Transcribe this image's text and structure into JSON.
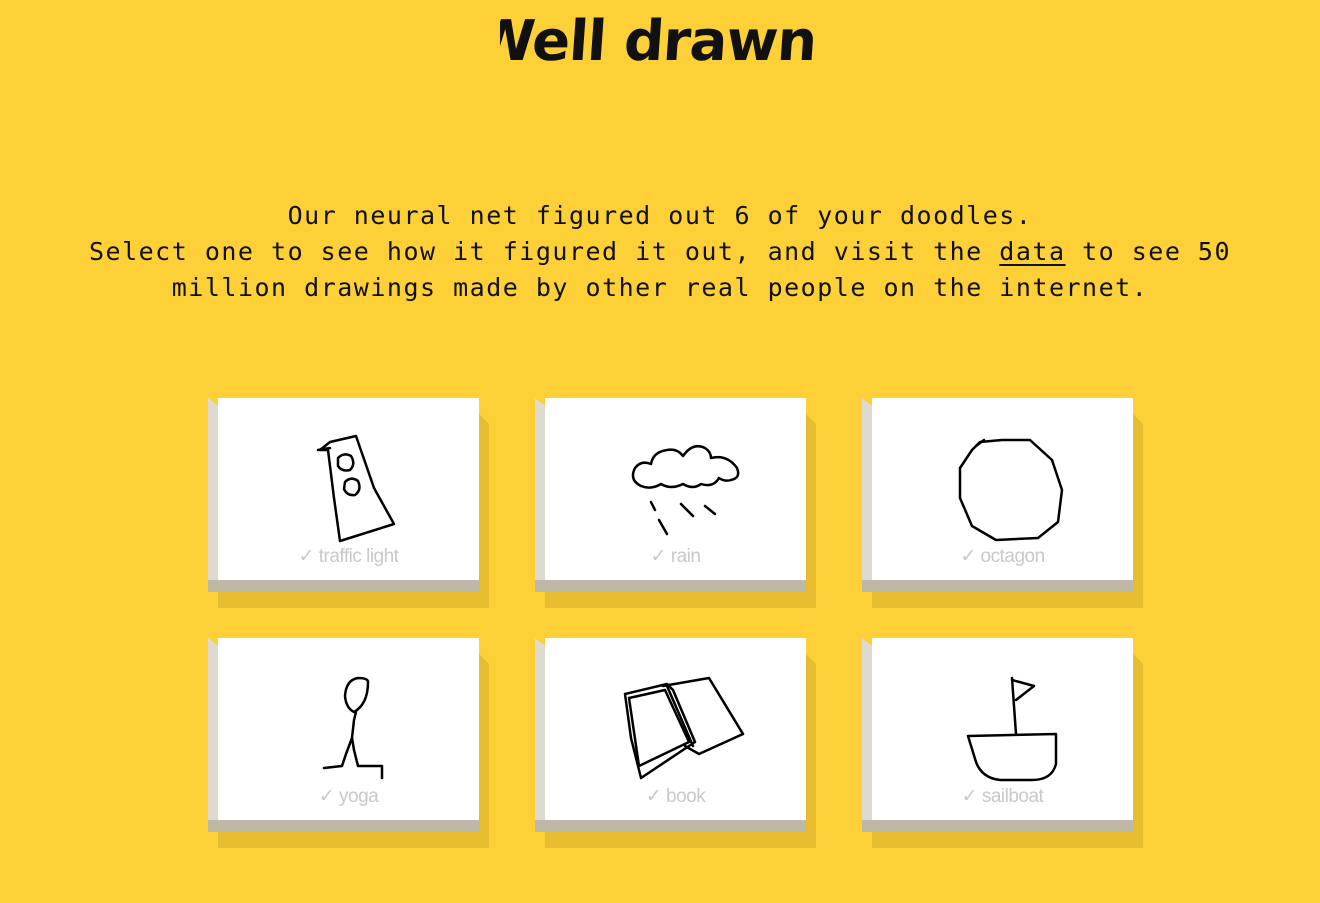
{
  "heading": "Well drawn!",
  "intro": {
    "line1": "Our neural net figured out 6 of your doodles.",
    "line2_before": "Select one to see how it figured it out, and visit the ",
    "data_link": "data",
    "line2_after": " to see 50 million drawings made by other real people on the internet."
  },
  "cards": [
    {
      "check": "✓",
      "label": "traffic light",
      "icon": "traffic-light-doodle"
    },
    {
      "check": "✓",
      "label": "rain",
      "icon": "rain-doodle"
    },
    {
      "check": "✓",
      "label": "octagon",
      "icon": "octagon-doodle"
    },
    {
      "check": "✓",
      "label": "yoga",
      "icon": "yoga-doodle"
    },
    {
      "check": "✓",
      "label": "book",
      "icon": "book-doodle"
    },
    {
      "check": "✓",
      "label": "sailboat",
      "icon": "sailboat-doodle"
    }
  ],
  "colors": {
    "background": "#fdd037",
    "card": "#ffffff",
    "label": "#c9c9c9"
  }
}
